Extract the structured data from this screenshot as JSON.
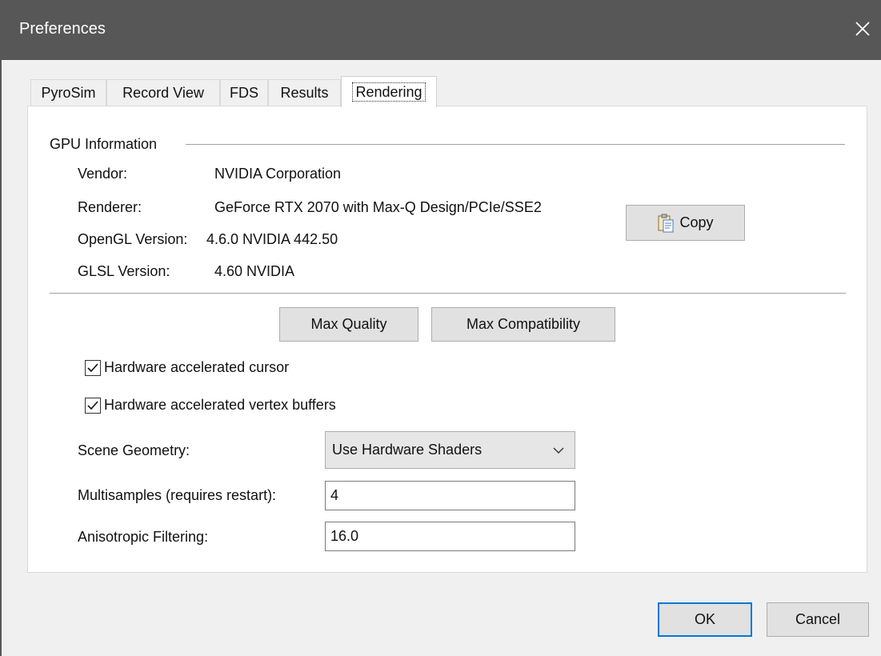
{
  "window": {
    "title": "Preferences"
  },
  "tabs": [
    {
      "label": "PyroSim"
    },
    {
      "label": "Record View"
    },
    {
      "label": "FDS"
    },
    {
      "label": "Results"
    },
    {
      "label": "Rendering",
      "active": true
    }
  ],
  "gpu": {
    "group_title": "GPU Information",
    "vendor_label": "Vendor:",
    "vendor_value": "NVIDIA Corporation",
    "renderer_label": "Renderer:",
    "renderer_value": "GeForce RTX 2070 with Max-Q Design/PCIe/SSE2",
    "opengl_label": "OpenGL Version:",
    "opengl_value": "4.6.0 NVIDIA 442.50",
    "glsl_label": "GLSL Version:",
    "glsl_value": "4.60 NVIDIA",
    "copy_button": "Copy",
    "copy_icon": "clipboard-icon"
  },
  "presets": {
    "max_quality": "Max Quality",
    "max_compatibility": "Max Compatibility"
  },
  "options": {
    "hw_cursor_label": "Hardware accelerated cursor",
    "hw_cursor_checked": true,
    "hw_vertex_label": "Hardware accelerated vertex buffers",
    "hw_vertex_checked": true
  },
  "settings": {
    "scene_geometry_label": "Scene Geometry:",
    "scene_geometry_value": "Use Hardware Shaders",
    "multisamples_label": "Multisamples (requires restart):",
    "multisamples_value": "4",
    "anisotropic_label": "Anisotropic Filtering:",
    "anisotropic_value": "16.0"
  },
  "footer": {
    "ok": "OK",
    "cancel": "Cancel"
  },
  "colors": {
    "titlebar": "#575757",
    "accent": "#0078d7"
  }
}
